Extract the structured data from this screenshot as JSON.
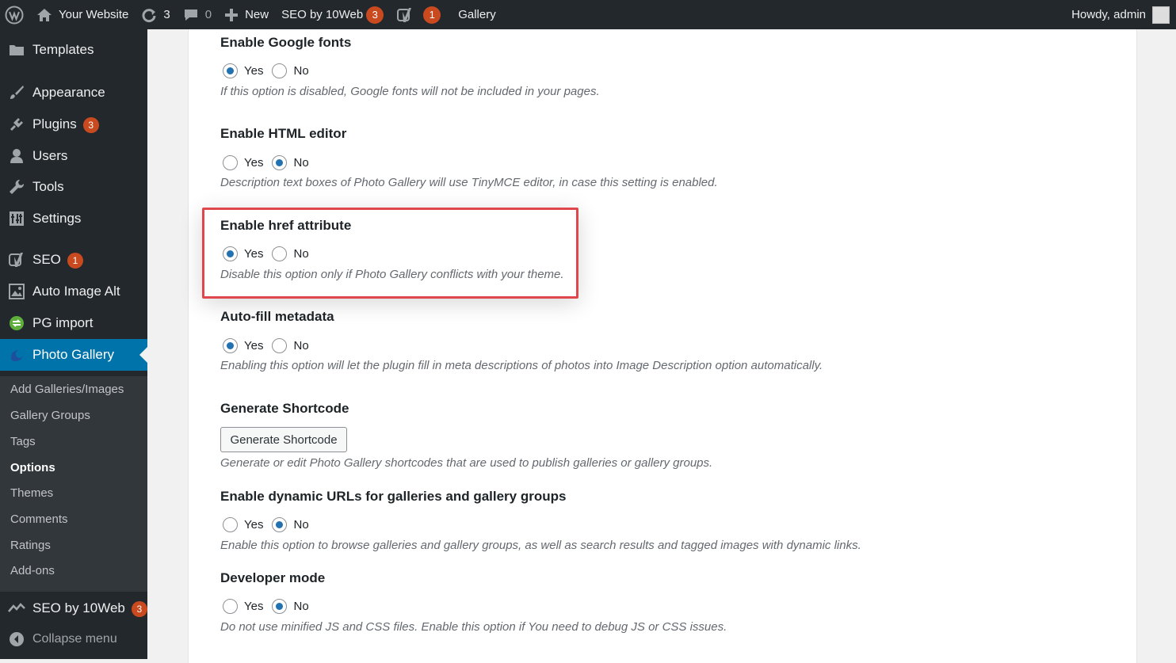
{
  "adminbar": {
    "site_name": "Your Website",
    "updates_count": "3",
    "comments_count": "0",
    "new_label": "New",
    "seo_label": "SEO by 10Web",
    "seo_count": "3",
    "yoast_count": "1",
    "gallery_label": "Gallery",
    "howdy": "Howdy, admin"
  },
  "sidebar": {
    "items": [
      {
        "label": "Templates",
        "icon": "folder-icon"
      },
      {
        "label": "Appearance",
        "icon": "paintbrush-icon"
      },
      {
        "label": "Plugins",
        "icon": "plug-icon",
        "count": "3"
      },
      {
        "label": "Users",
        "icon": "user-icon"
      },
      {
        "label": "Tools",
        "icon": "wrench-icon"
      },
      {
        "label": "Settings",
        "icon": "settings-icon"
      },
      {
        "label": "SEO",
        "icon": "yoast-icon",
        "count": "1"
      },
      {
        "label": "Auto Image Alt",
        "icon": "image-alt-icon"
      },
      {
        "label": "PG import",
        "icon": "pg-import-icon"
      },
      {
        "label": "Photo Gallery",
        "icon": "photo-gallery-icon"
      }
    ],
    "submenu": [
      "Add Galleries/Images",
      "Gallery Groups",
      "Tags",
      "Options",
      "Themes",
      "Comments",
      "Ratings",
      "Add-ons"
    ],
    "bottom": [
      {
        "label": "SEO by 10Web",
        "icon": "seo-10web-icon",
        "count": "3"
      },
      {
        "label": "Collapse menu",
        "icon": "collapse-icon"
      }
    ]
  },
  "radio_labels": {
    "yes": "Yes",
    "no": "No"
  },
  "options": [
    {
      "title": "Enable Google fonts",
      "selected": "yes",
      "desc": "If this option is disabled, Google fonts will not be included in your pages."
    },
    {
      "title": "Enable HTML editor",
      "selected": "no",
      "desc": "Description text boxes of Photo Gallery will use TinyMCE editor, in case this setting is enabled."
    },
    {
      "title": "Enable href attribute",
      "selected": "yes",
      "desc": "Disable this option only if Photo Gallery conflicts with your theme."
    },
    {
      "title": "Auto-fill metadata",
      "selected": "yes",
      "desc": "Enabling this option will let the plugin fill in meta descriptions of photos into Image Description option automatically."
    },
    {
      "title": "Generate Shortcode",
      "button": "Generate Shortcode",
      "desc": "Generate or edit Photo Gallery shortcodes that are used to publish galleries or gallery groups."
    },
    {
      "title": "Enable dynamic URLs for galleries and gallery groups",
      "selected": "no",
      "desc": "Enable this option to browse galleries and gallery groups, as well as search results and tagged images with dynamic links."
    },
    {
      "title": "Developer mode",
      "selected": "no",
      "desc": "Do not use minified JS and CSS files. Enable this option if You need to debug JS or CSS issues."
    }
  ],
  "colors": {
    "sidebar_bg": "#23282d",
    "active": "#0073aa",
    "badge": "#ca4a1f",
    "highlight_border": "#e0474c"
  }
}
